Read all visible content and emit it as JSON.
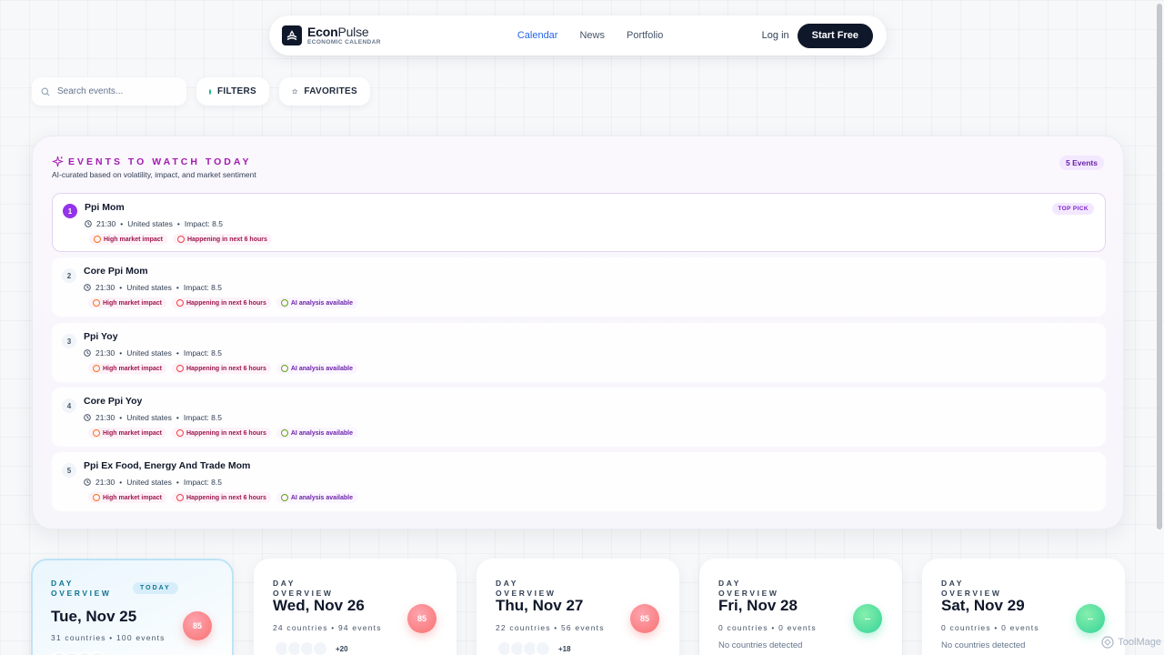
{
  "nav": {
    "brand_bold": "Econ",
    "brand_light": "Pulse",
    "brand_sub": "ECONOMIC CALENDAR",
    "links": [
      "Calendar",
      "News",
      "Portfolio"
    ],
    "login": "Log in",
    "cta": "Start Free"
  },
  "toolbar": {
    "search_placeholder": "Search events...",
    "filters": "FILTERS",
    "favorites": "FAVORITES"
  },
  "watch": {
    "title": "EVENTS TO WATCH TODAY",
    "subtitle": "AI-curated based on volatility, impact, and market sentiment",
    "count": "5 Events",
    "top_pick": "TOP PICK",
    "events": [
      {
        "rank": "1",
        "name": "Ppi Mom",
        "time": "21:30",
        "country": "United states",
        "impact": "Impact: 8.5",
        "tags": [
          "High market impact",
          "Happening in next 6 hours"
        ]
      },
      {
        "rank": "2",
        "name": "Core Ppi Mom",
        "time": "21:30",
        "country": "United states",
        "impact": "Impact: 8.5",
        "tags": [
          "High market impact",
          "Happening in next 6 hours",
          "AI analysis available"
        ]
      },
      {
        "rank": "3",
        "name": "Ppi Yoy",
        "time": "21:30",
        "country": "United states",
        "impact": "Impact: 8.5",
        "tags": [
          "High market impact",
          "Happening in next 6 hours",
          "AI analysis available"
        ]
      },
      {
        "rank": "4",
        "name": "Core Ppi Yoy",
        "time": "21:30",
        "country": "United states",
        "impact": "Impact: 8.5",
        "tags": [
          "High market impact",
          "Happening in next 6 hours",
          "AI analysis available"
        ]
      },
      {
        "rank": "5",
        "name": "Ppi Ex Food, Energy And Trade Mom",
        "time": "21:30",
        "country": "United states",
        "impact": "Impact: 8.5",
        "tags": [
          "High market impact",
          "Happening in next 6 hours",
          "AI analysis available"
        ]
      }
    ]
  },
  "days": [
    {
      "label": "DAY OVERVIEW",
      "badge": "TODAY",
      "date": "Tue, Nov 25",
      "stats": "31 countries  •  100 events",
      "score": "85",
      "more": ""
    },
    {
      "label": "DAY OVERVIEW",
      "date": "Wed, Nov 26",
      "stats": "24 countries  •  94 events",
      "score": "85",
      "more": "+20"
    },
    {
      "label": "DAY OVERVIEW",
      "date": "Thu, Nov 27",
      "stats": "22 countries  •  56 events",
      "score": "85",
      "more": "+18"
    },
    {
      "label": "DAY OVERVIEW",
      "date": "Fri, Nov 28",
      "stats": "0 countries  •  0 events",
      "score": "--",
      "empty": "No countries detected"
    },
    {
      "label": "DAY OVERVIEW",
      "date": "Sat, Nov 29",
      "stats": "0 countries  •  0 events",
      "score": "--",
      "empty": "No countries detected"
    }
  ],
  "watermark": "ToolMage",
  "colors": {
    "accent": "#2563eb",
    "purple": "#9333ea",
    "dark": "#0f172a",
    "green": "#34d399",
    "red": "#f87171"
  }
}
